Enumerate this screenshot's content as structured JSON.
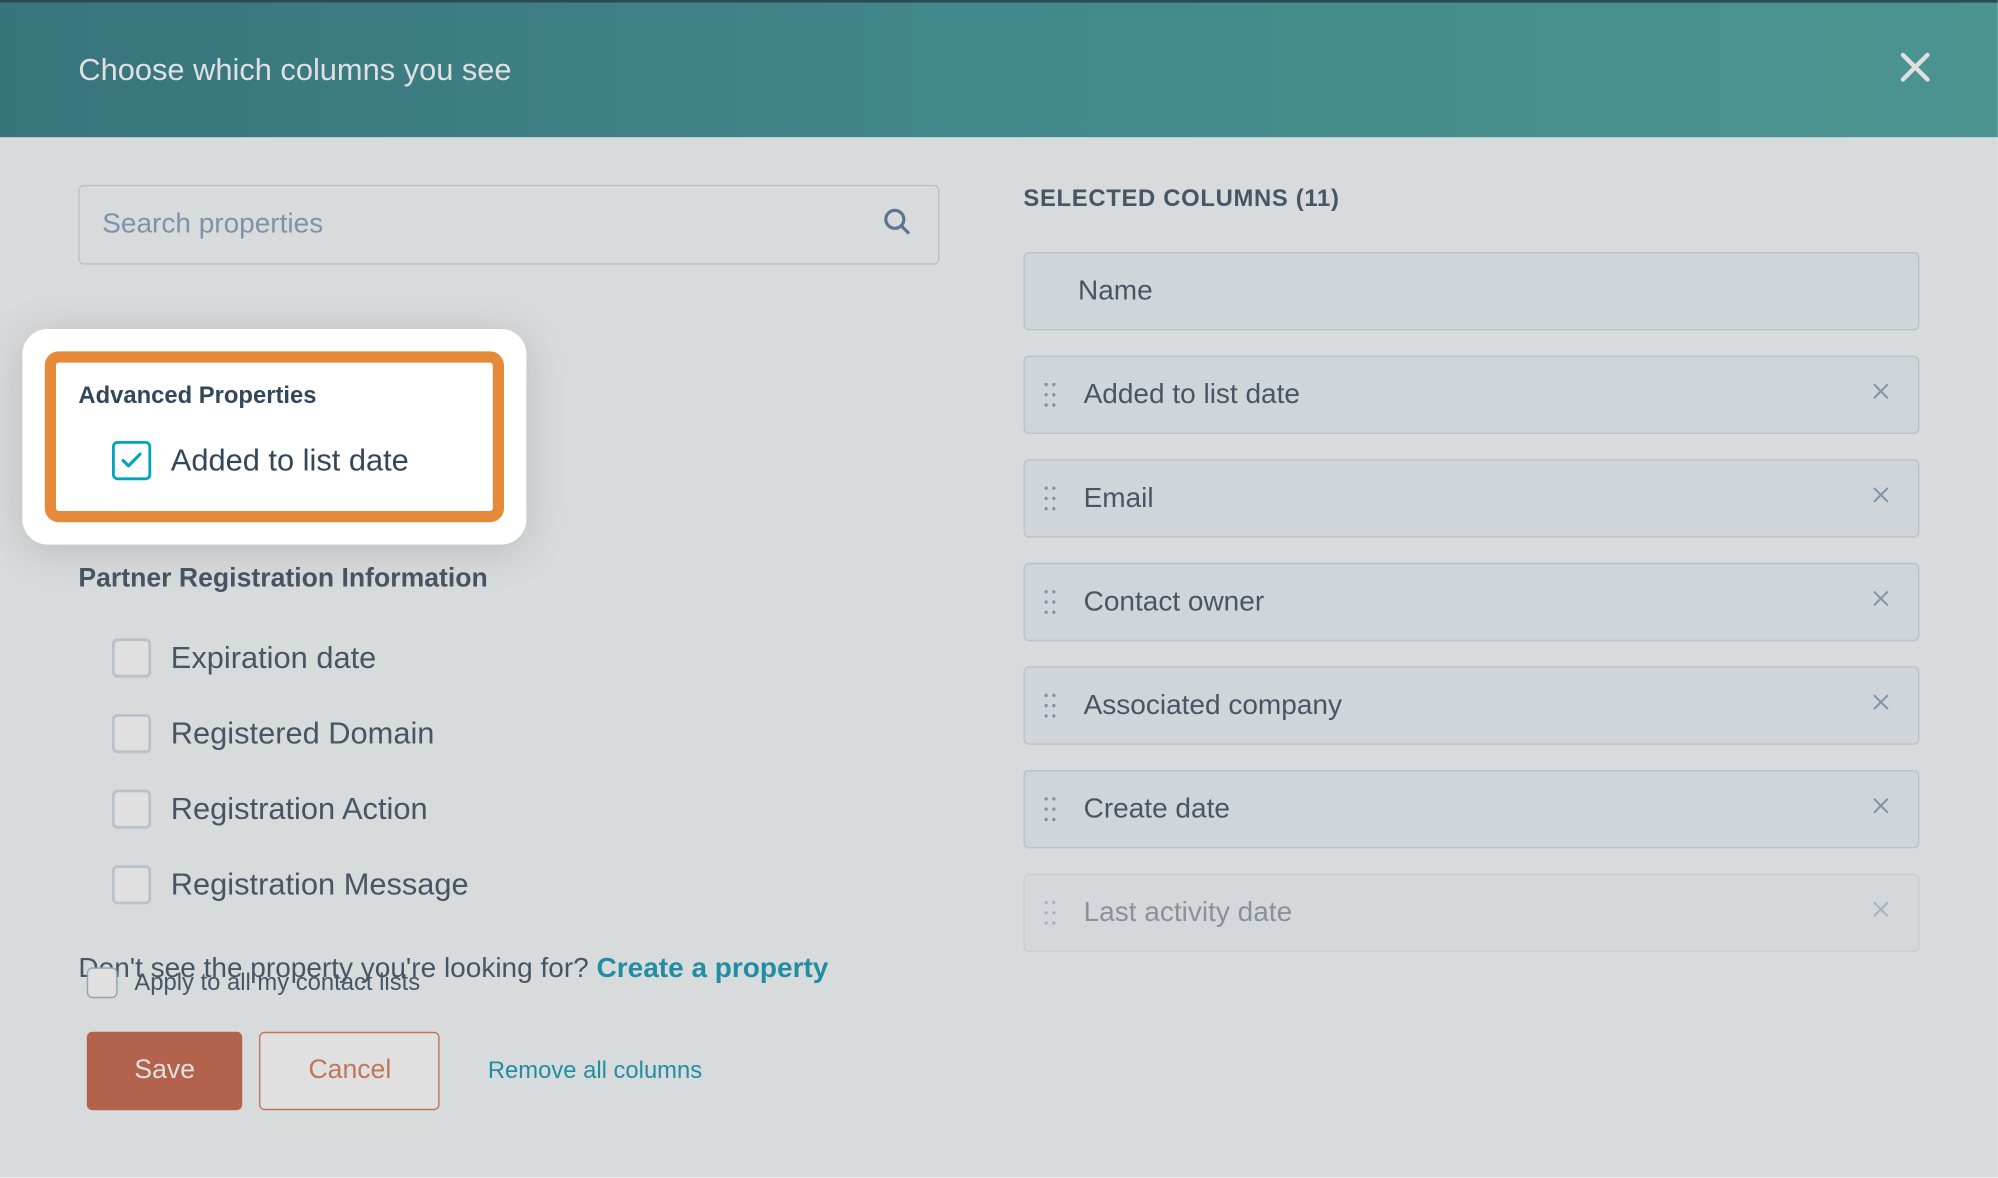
{
  "header": {
    "title": "Choose which columns you see"
  },
  "search": {
    "placeholder": "Search properties"
  },
  "left": {
    "highlight_group": "Advanced Properties",
    "highlight_item": "Added to list date",
    "group2": "Partner Registration Information",
    "items": [
      {
        "label": "Expiration date"
      },
      {
        "label": "Registered Domain"
      },
      {
        "label": "Registration Action"
      },
      {
        "label": "Registration Message"
      }
    ],
    "helper_text": "Don't see the property you're looking for? ",
    "helper_link": "Create a property"
  },
  "right": {
    "heading": "SELECTED COLUMNS (11)",
    "locked": "Name",
    "items": [
      "Added to list date",
      "Email",
      "Contact owner",
      "Associated company",
      "Create date",
      "Last activity date"
    ]
  },
  "footer": {
    "apply_label": "Apply to all my contact lists",
    "save": "Save",
    "cancel": "Cancel",
    "remove_all": "Remove all columns"
  }
}
